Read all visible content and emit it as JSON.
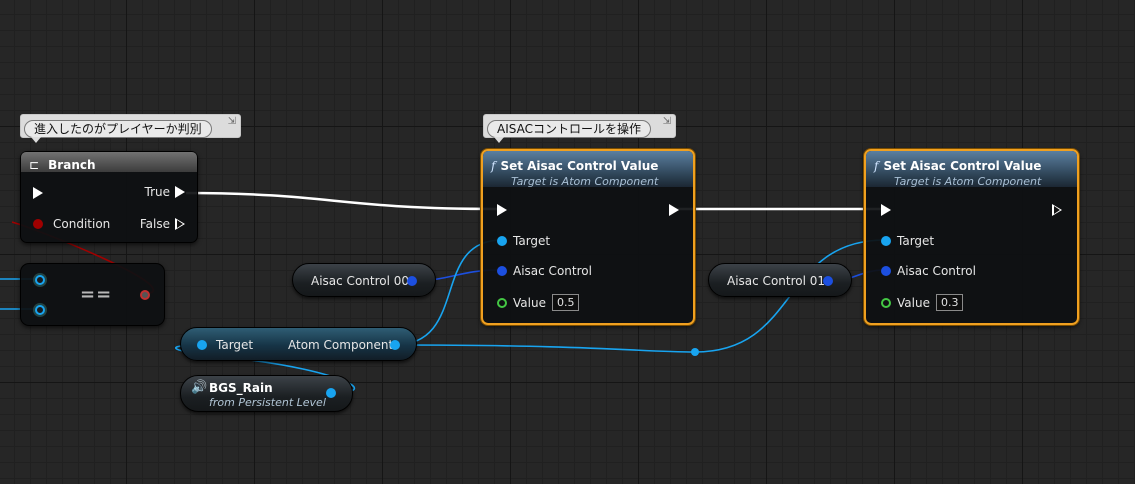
{
  "comments": {
    "branch_comment": "進入したのがプレイヤーか判別",
    "aisac_comment": "AISACコントロールを操作",
    "pin_glyph": "⇲"
  },
  "branch": {
    "title": "Branch",
    "true_label": "True",
    "false_label": "False",
    "condition_label": "Condition"
  },
  "equal_node": {
    "symbol": "=="
  },
  "aisac_value_node_1": {
    "title": "Set Aisac Control Value",
    "subtitle": "Target is Atom Component",
    "target_label": "Target",
    "aisac_control_label": "Aisac Control",
    "value_label": "Value",
    "value": "0.5"
  },
  "aisac_value_node_2": {
    "title": "Set Aisac Control Value",
    "subtitle": "Target is Atom Component",
    "target_label": "Target",
    "aisac_control_label": "Aisac Control",
    "value_label": "Value",
    "value": "0.3"
  },
  "aisac_control_00": {
    "label": "Aisac Control 00"
  },
  "aisac_control_01": {
    "label": "Aisac Control 01"
  },
  "atom_component_getter": {
    "target_label": "Target",
    "output_label": "Atom Component"
  },
  "bgs_rain": {
    "title": "BGS_Rain",
    "subtitle": "from Persistent Level"
  },
  "colors": {
    "exec_wire": "#ffffff",
    "object_pin": "#18a4f0",
    "float_pin": "#1c4fe0",
    "bool_pin": "#a00000",
    "selection": "#f0a020"
  }
}
